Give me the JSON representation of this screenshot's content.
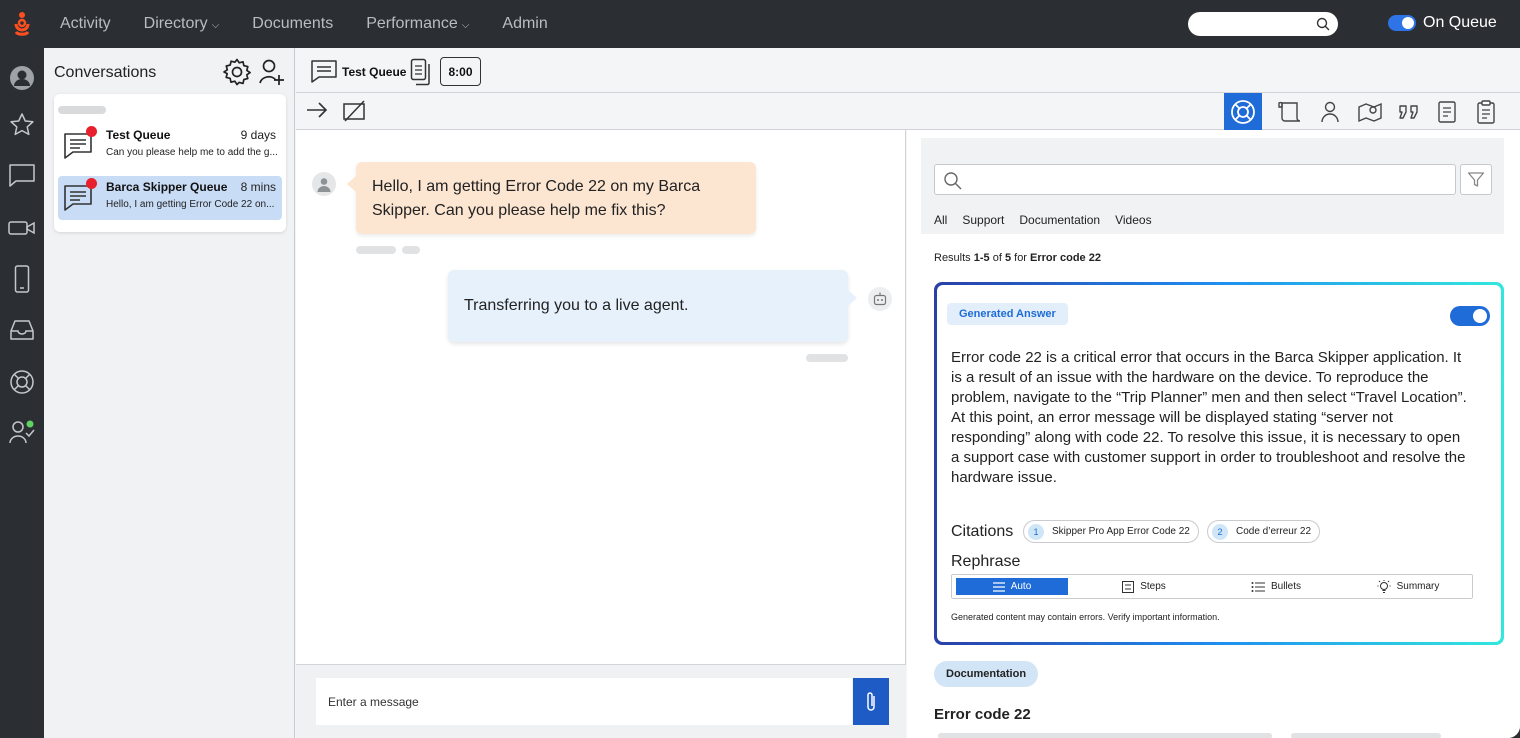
{
  "nav": {
    "items": [
      {
        "label": "Activity",
        "chevron": false
      },
      {
        "label": "Directory",
        "chevron": true
      },
      {
        "label": "Documents",
        "chevron": false
      },
      {
        "label": "Performance",
        "chevron": true
      },
      {
        "label": "Admin",
        "chevron": false
      }
    ],
    "status_label": "On Queue"
  },
  "colors": {
    "brand": "#ff4f1f",
    "accent": "#1f6bd7",
    "unread_dot": "#e8202e"
  },
  "conversations": {
    "title": "Conversations",
    "items": [
      {
        "name": "Test Queue",
        "time": "9 days",
        "preview": "Can you please help me to add the g...",
        "unread": true,
        "active": false
      },
      {
        "name": "Barca Skipper Queue",
        "time": "8 mins",
        "preview": "Hello, I am getting Error Code 22 on...",
        "unread": true,
        "active": true
      }
    ]
  },
  "interaction": {
    "queue_name": "Test Queue",
    "timer": "8:00"
  },
  "chat": {
    "customer_message": "Hello, I am getting Error Code 22 on my Barca Skipper. Can you please help me fix this?",
    "bot_message": "Transferring you to a live agent.",
    "composer_placeholder": "Enter a message"
  },
  "knowledge": {
    "tabs": [
      "All",
      "Support",
      "Documentation",
      "Videos"
    ],
    "results": {
      "prefix": "Results ",
      "range": "1-5",
      "of": " of ",
      "total": "5",
      "for": " for ",
      "query": "Error code 22"
    },
    "generated": {
      "badge": "Generated Answer",
      "answer": "Error code 22 is a critical error that occurs in the Barca Skipper application. It is a result of an issue with the hardware on the device. To reproduce the problem, navigate to the “Trip Planner” men and then select “Travel Location”. At this point, an error message will be displayed stating “server not responding” along with code 22. To resolve this issue, it is necessary to open a support case with customer support in order to troubleshoot and resolve the hardware issue.",
      "citations_label": "Citations",
      "citations": [
        {
          "num": "1",
          "label": "Skipper Pro App Error Code 22"
        },
        {
          "num": "2",
          "label": "Code d’erreur 22"
        }
      ],
      "rephrase_label": "Rephrase",
      "rephrase_options": [
        "Auto",
        "Steps",
        "Bullets",
        "Summary"
      ],
      "disclaimer": "Generated content may contain errors. Verify important information."
    },
    "doc_badge": "Documentation",
    "doc_title": "Error code 22"
  }
}
